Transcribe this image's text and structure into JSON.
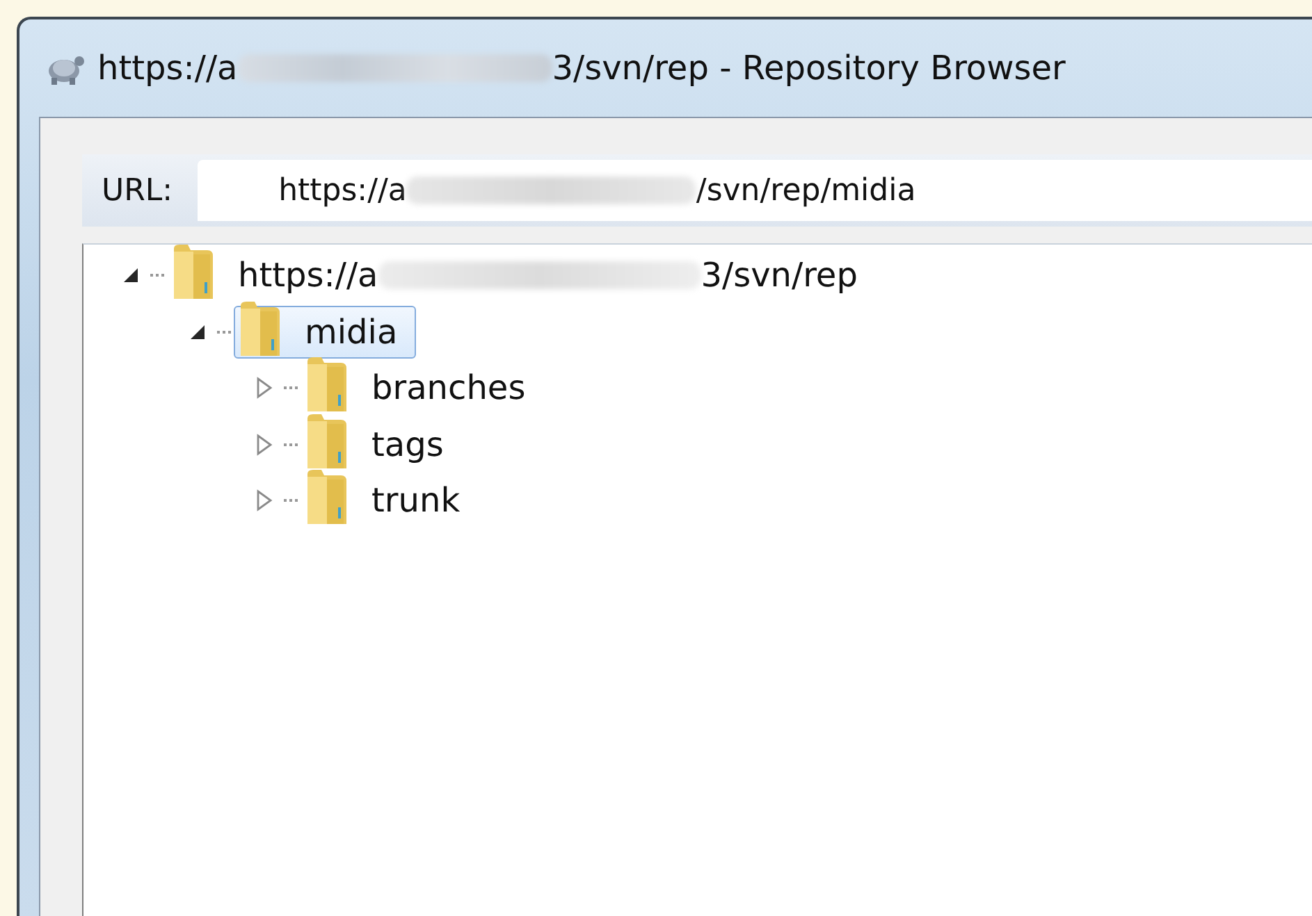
{
  "window": {
    "title_parts": [
      "https://a",
      "3/svn/rep - Repository Browser"
    ]
  },
  "url": {
    "label": "URL:",
    "value_parts": [
      "https://a",
      "/svn/rep/midia"
    ]
  },
  "tree": [
    {
      "label_parts": [
        "https://a",
        "3/svn/rep"
      ],
      "expanded": true,
      "selected": false,
      "children": [
        {
          "label_parts": [
            "midia"
          ],
          "expanded": true,
          "selected": true,
          "children": [
            {
              "label_parts": [
                "branches"
              ],
              "expanded": false,
              "selected": false
            },
            {
              "label_parts": [
                "tags"
              ],
              "expanded": false,
              "selected": false
            },
            {
              "label_parts": [
                "trunk"
              ],
              "expanded": false,
              "selected": false
            }
          ]
        }
      ]
    }
  ]
}
